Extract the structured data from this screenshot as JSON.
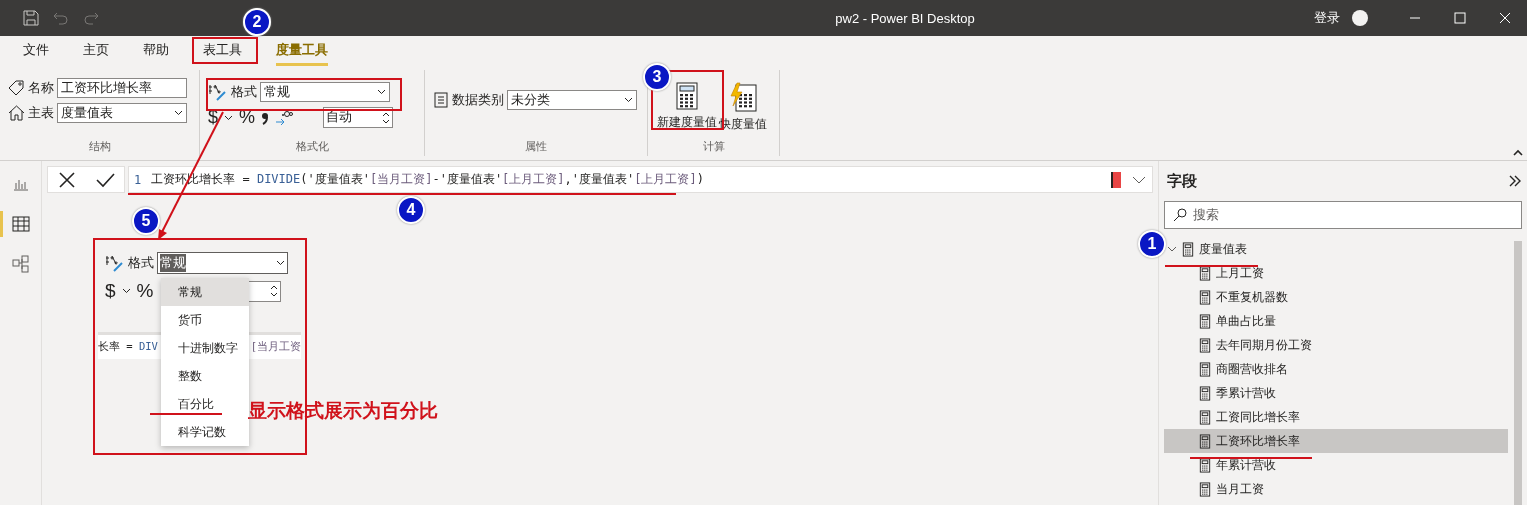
{
  "window": {
    "title": "pw2 - Power BI Desktop",
    "sign_in": "登录"
  },
  "tabs": [
    {
      "label": "文件",
      "selected": false
    },
    {
      "label": "主页",
      "selected": false
    },
    {
      "label": "帮助",
      "selected": false
    },
    {
      "label": "表工具",
      "selected": false
    },
    {
      "label": "度量工具",
      "selected": true
    }
  ],
  "ribbon": {
    "structure": {
      "name_label": "名称",
      "name_value": "工资环比增长率",
      "home_label": "主表",
      "home_value": "度量值表",
      "group_label": "结构"
    },
    "formatting": {
      "format_label": "格式",
      "format_value": "常规",
      "currency": "$",
      "percent": "%",
      "decimals_value": "自动",
      "group_label": "格式化"
    },
    "properties": {
      "category_label": "数据类别",
      "category_value": "未分类",
      "group_label": "属性"
    },
    "calculations": {
      "buttons": [
        {
          "label": "新建度量值",
          "kind": "new"
        },
        {
          "label": "快度量值",
          "kind": "quick"
        }
      ],
      "group_label": "计算"
    }
  },
  "views": [
    {
      "kind": "report",
      "selected": false
    },
    {
      "kind": "data",
      "selected": true
    },
    {
      "kind": "model",
      "selected": false
    }
  ],
  "formula_bar": {
    "line_number": "1",
    "tokens": [
      {
        "text": "工资环比增长率",
        "kind": "name"
      },
      {
        "text": " = ",
        "kind": "op"
      },
      {
        "text": "DIVIDE",
        "kind": "func"
      },
      {
        "text": "(",
        "kind": "op"
      },
      {
        "text": "'度量值表'",
        "kind": "table"
      },
      {
        "text": "[当月工资]",
        "kind": "column"
      },
      {
        "text": "-",
        "kind": "op"
      },
      {
        "text": "'度量值表'",
        "kind": "table"
      },
      {
        "text": "[上月工资]",
        "kind": "column"
      },
      {
        "text": ",",
        "kind": "op"
      },
      {
        "text": "'度量值表'",
        "kind": "table"
      },
      {
        "text": "[上月工资]",
        "kind": "column"
      },
      {
        "text": ")",
        "kind": "op"
      }
    ]
  },
  "fields_pane": {
    "title": "字段",
    "search_placeholder": "搜索",
    "tables": [
      {
        "name": "度量值表",
        "expanded": true,
        "children": [
          {
            "name": "上月工资",
            "selected": false
          },
          {
            "name": "不重复机器数",
            "selected": false
          },
          {
            "name": "单曲占比量",
            "selected": false
          },
          {
            "name": "去年同期月份工资",
            "selected": false
          },
          {
            "name": "商圈营收排名",
            "selected": false
          },
          {
            "name": "季累计营收",
            "selected": false
          },
          {
            "name": "工资同比增长率",
            "selected": false
          },
          {
            "name": "工资环比增长率",
            "selected": true
          },
          {
            "name": "年累计营收",
            "selected": false
          },
          {
            "name": "当月工资",
            "selected": false
          }
        ]
      }
    ]
  },
  "inset": {
    "format_label": "格式",
    "format_value": "常规",
    "currency": "$",
    "percent": "%",
    "formula_left": [
      {
        "text": "长率 = ",
        "kind": "name"
      },
      {
        "text": "DIV",
        "kind": "func"
      }
    ],
    "formula_right": [
      {
        "text": "[当月工资",
        "kind": "column"
      }
    ],
    "options": [
      {
        "label": "常规",
        "selected": true
      },
      {
        "label": "货币",
        "selected": false
      },
      {
        "label": "十进制数字",
        "selected": false
      },
      {
        "label": "整数",
        "selected": false
      },
      {
        "label": "百分比",
        "selected": false
      },
      {
        "label": "科学记数",
        "selected": false
      }
    ],
    "note": "显示格式展示为百分比"
  },
  "annotations": [
    {
      "number": "1"
    },
    {
      "number": "2"
    },
    {
      "number": "3"
    },
    {
      "number": "4"
    },
    {
      "number": "5"
    }
  ]
}
